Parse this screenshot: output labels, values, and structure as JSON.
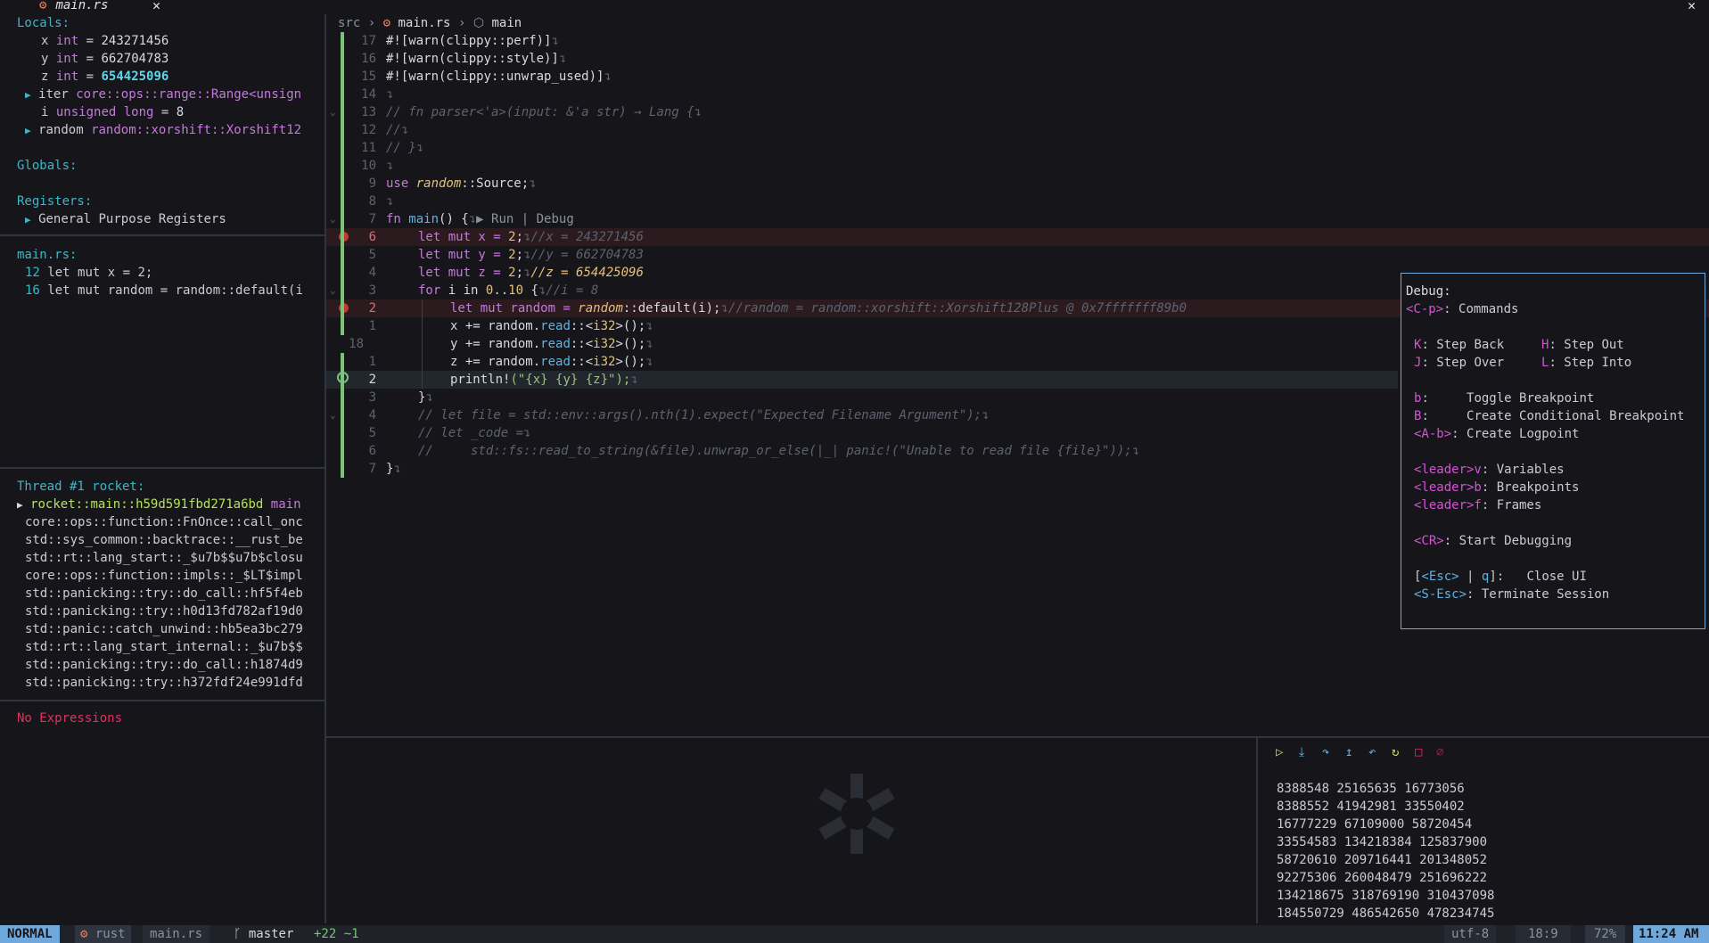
{
  "tab": {
    "icon": "rust-file-icon",
    "name": "main.rs",
    "close": "✕"
  },
  "window_close": "✕",
  "scopes": {
    "locals_header": "Locals:",
    "locals": [
      {
        "name": "x",
        "type": "int",
        "eq": "=",
        "value": "243271456"
      },
      {
        "name": "y",
        "type": "int",
        "eq": "=",
        "value": "662704783"
      },
      {
        "name": "z",
        "type": "int",
        "eq": "=",
        "value": "654425096"
      },
      {
        "name": "iter",
        "type": "core::ops::range::Range<unsign"
      },
      {
        "name": "i",
        "type": "unsigned long",
        "eq": "=",
        "value": "8"
      },
      {
        "name": "random",
        "type": "random::xorshift::Xorshift12"
      }
    ],
    "globals_header": "Globals:",
    "registers_header": "Registers:",
    "registers_item": "General Purpose Registers"
  },
  "breakpoints": {
    "file": "main.rs:",
    "items": [
      {
        "line": "12",
        "text": "let mut x = 2;"
      },
      {
        "line": "16",
        "text": "let mut random = random::default(i"
      }
    ]
  },
  "stacks": {
    "thread": "Thread #1 rocket:",
    "frames": [
      {
        "name": "rocket::main::h59d591fbd271a6bd",
        "suffix": "main"
      },
      {
        "name": "core::ops::function::FnOnce::call_onc"
      },
      {
        "name": "std::sys_common::backtrace::__rust_be"
      },
      {
        "name": "std::rt::lang_start::_$u7b$$u7b$closu"
      },
      {
        "name": "core::ops::function::impls::_$LT$impl"
      },
      {
        "name": "std::panicking::try::do_call::hf5f4eb"
      },
      {
        "name": "std::panicking::try::h0d13fd782af19d0"
      },
      {
        "name": "std::panic::catch_unwind::hb5ea3bc279"
      },
      {
        "name": "std::rt::lang_start_internal::_$u7b$$"
      },
      {
        "name": "std::panicking::try::do_call::h1874d9"
      },
      {
        "name": "std::panicking::try::h372fdf24e991dfd"
      }
    ]
  },
  "watches": {
    "empty": "No Expressions"
  },
  "breadcrumb": {
    "dir": "src",
    "sep": "›",
    "file": "main.rs",
    "symbol": "main"
  },
  "editor": {
    "ret": "↴",
    "lines": {
      "l1": {
        "num": "17",
        "code": "#![warn(clippy::perf)]"
      },
      "l2": {
        "num": "16",
        "code": "#![warn(clippy::style)]"
      },
      "l3": {
        "num": "15",
        "code": "#![warn(clippy::unwrap_used)]"
      },
      "l4": {
        "num": "14",
        "code": ""
      },
      "l5": {
        "num": "13",
        "code": "// fn parser<'a>(input: &'a str) → Lang {"
      },
      "l6": {
        "num": "12",
        "code": "//"
      },
      "l7": {
        "num": "11",
        "code": "// }"
      },
      "l8": {
        "num": "10",
        "code": ""
      },
      "l9": {
        "num": "9",
        "a": "use ",
        "b": "random",
        "c": "::Source;"
      },
      "l10": {
        "num": "8",
        "code": ""
      },
      "l11": {
        "num": "7",
        "a": "fn ",
        "b": "main",
        "c": "() {",
        "lens_run": "▶ Run",
        "lens_debug": " | Debug"
      },
      "l12": {
        "num": "6",
        "a": "let mut x = ",
        "b": "2",
        "c": ";",
        "virt": "//x = 243271456"
      },
      "l13": {
        "num": "5",
        "a": "let mut y = ",
        "b": "2",
        "c": ";",
        "virt": "//y = 662704783"
      },
      "l14": {
        "num": "4",
        "a": "let mut z = ",
        "b": "2",
        "c": ";",
        "virt": "//z = 654425096"
      },
      "l15": {
        "num": "3",
        "a": "for ",
        "b": "i in ",
        "c": "0",
        "d": "..",
        "e": "10",
        "f": " {",
        "virt": "//i = 8"
      },
      "l16": {
        "num": "2",
        "a": "let mut random = ",
        "b": "random",
        "c": "::default(i);",
        "virt": "//random = random::xorshift::Xorshift128Plus @ 0x7fffffff89b0"
      },
      "l17": {
        "num": "1",
        "a": "x += random.",
        "b": "read",
        "c": "::<",
        "d": "i32",
        "e": ">();"
      },
      "l18": {
        "num": "18",
        "a": "y += random.",
        "b": "read",
        "c": "::<",
        "d": "i32",
        "e": ">();"
      },
      "l19": {
        "num": "1",
        "a": "z += random.",
        "b": "read",
        "c": "::<",
        "d": "i32",
        "e": ">();"
      },
      "l20": {
        "num": "2",
        "a": "println!",
        "b": "(\"{x} {y} {z}\");"
      },
      "l21": {
        "num": "3",
        "code": "}"
      },
      "l22": {
        "num": "4",
        "code": "// let file = std::env::args().nth(1).expect(\"Expected Filename Argument\");"
      },
      "l23": {
        "num": "5",
        "code": "// let _code ="
      },
      "l24": {
        "num": "6",
        "code": "//     std::fs::read_to_string(&file).unwrap_or_else(|_| panic!(\"Unable to read file {file}\"));"
      },
      "l25": {
        "num": "7",
        "code": "}"
      }
    }
  },
  "help": {
    "title": "Debug:",
    "commands": {
      "key": "<C-p>",
      "label": ": Commands"
    },
    "step_back": {
      "key": "K",
      "label": ": Step Back"
    },
    "step_out": {
      "key": "H",
      "label": ": Step Out"
    },
    "step_over": {
      "key": "J",
      "label": ": Step Over"
    },
    "step_into": {
      "key": "L",
      "label": ": Step Into"
    },
    "toggle_bp": {
      "key": "b",
      "label": ":     Toggle Breakpoint"
    },
    "cond_bp": {
      "key": "B",
      "label": ":     Create Conditional Breakpoint"
    },
    "logpoint": {
      "key": "<A-b>",
      "label": ": Create Logpoint"
    },
    "variables": {
      "key": "<leader>v",
      "label": ": Variables"
    },
    "bps": {
      "key": "<leader>b",
      "label": ": Breakpoints"
    },
    "frames": {
      "key": "<leader>f",
      "label": ": Frames"
    },
    "start": {
      "key": "<CR>",
      "label": ": Start Debugging"
    },
    "close_pre": "[",
    "close_k1": "<Esc>",
    "close_mid": " | ",
    "close_k2": "q",
    "close_label": "]:   Close UI",
    "terminate": {
      "key": "<S-Esc>",
      "label": ": Terminate Session"
    }
  },
  "console": {
    "lines": [
      "8388548 25165635 16773056",
      "8388552 41942981 33550402",
      "16777229 67109000 58720454",
      "33554583 134218384 125837900",
      "58720610 209716441 201348052",
      "92275306 260048479 251696222",
      "134218675 318769190 310437098",
      "184550729 486542650 478234745"
    ]
  },
  "statusline": {
    "mode": "NORMAL",
    "filetype": "rust",
    "file": "main.rs",
    "branch_icon": "ᚴ",
    "branch": "master",
    "diff": "+22 ~1",
    "encoding": "utf-8",
    "position": "18:9",
    "percent": "72%",
    "time": "11:24 AM"
  }
}
